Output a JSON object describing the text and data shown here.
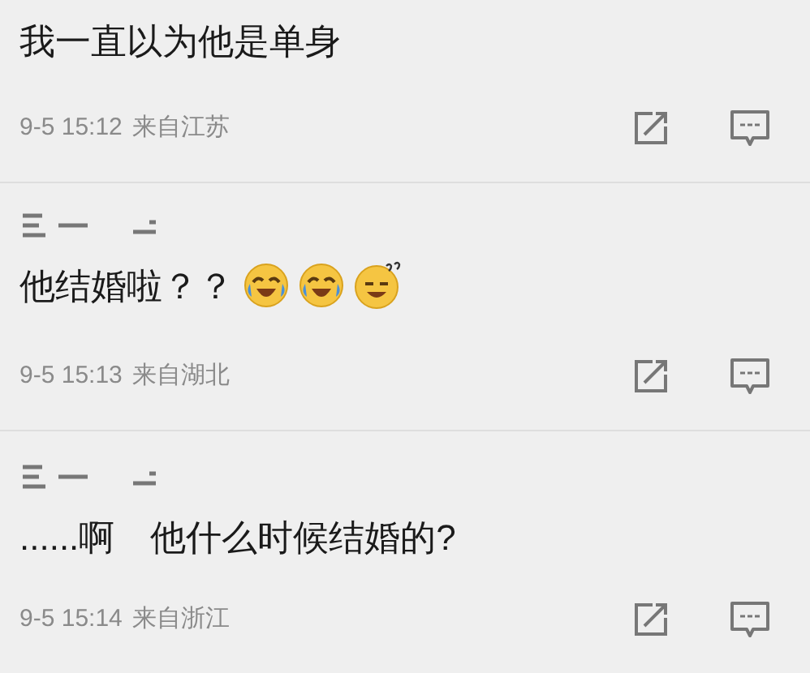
{
  "comments": [
    {
      "erased": false,
      "text": "我一直以为他是单身",
      "time": "9-5 15:12",
      "source": "来自江苏"
    },
    {
      "erased": true,
      "text": "他结婚啦？？",
      "reactions": [
        {
          "kind": "laugh_cry"
        },
        {
          "kind": "laugh_cry"
        },
        {
          "kind": "confused"
        }
      ],
      "time": "9-5 15:13",
      "source": "来自湖北"
    },
    {
      "erased": true,
      "text": "......啊　他什么时候结婚的?",
      "time": "9-5 15:14",
      "source": "来自浙江"
    }
  ]
}
